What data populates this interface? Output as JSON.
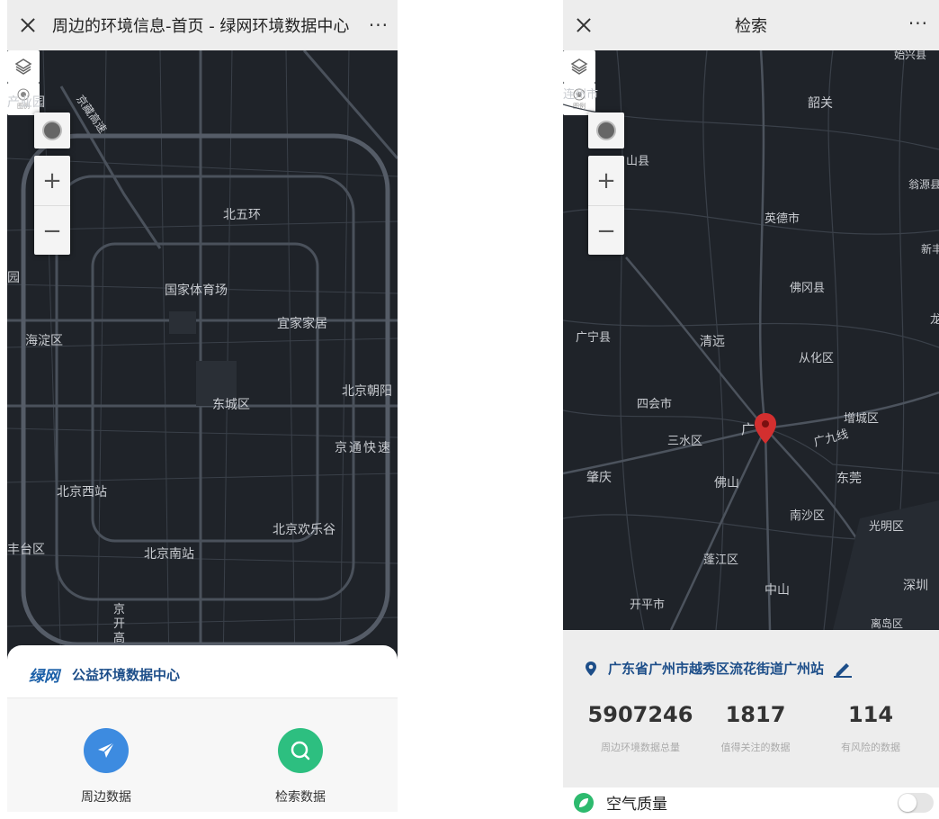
{
  "left": {
    "title": "周边的环境信息-首页 - 绿网环境数据中心",
    "more": "···",
    "map_labels": [
      "产业园",
      "京藏高速",
      "北五环",
      "园",
      "国家体育场",
      "宜家家居",
      "海淀区",
      "北京朝阳",
      "东城区",
      "京通快速",
      "北京西站",
      "北京欢乐谷",
      "丰台区",
      "北京南站",
      "京开高"
    ],
    "zoom_in": "+",
    "zoom_out": "−",
    "legend": "图例",
    "brand_logo_a": "绿",
    "brand_logo_b": "网",
    "brand_name": "公益环境数据中心",
    "actions": [
      {
        "label": "周边数据",
        "color": "#3d8be0"
      },
      {
        "label": "检索数据",
        "color": "#2dbf80"
      }
    ]
  },
  "right": {
    "title": "检索",
    "more": "···",
    "map_labels": [
      "始兴县",
      "连州市",
      "韶关",
      "山县",
      "翁源县",
      "英德市",
      "新丰",
      "佛冈县",
      "广宁县",
      "清远",
      "从化区",
      "四会市",
      "增城区",
      "三水区",
      "广",
      "广九线",
      "肇庆",
      "佛山",
      "东莞",
      "南沙区",
      "光明区",
      "蓬江区",
      "中山",
      "深圳",
      "开平市",
      "离岛区",
      "龙"
    ],
    "zoom_in": "+",
    "zoom_out": "−",
    "legend": "图例",
    "address": "广东省广州市越秀区流花街道广州站",
    "stats": [
      {
        "value": "5907246",
        "label": "周边环境数据总量"
      },
      {
        "value": "1817",
        "label": "值得关注的数据"
      },
      {
        "value": "114",
        "label": "有风险的数据"
      }
    ],
    "toggle_label": "空气质量",
    "accent": "#1d4e89"
  }
}
